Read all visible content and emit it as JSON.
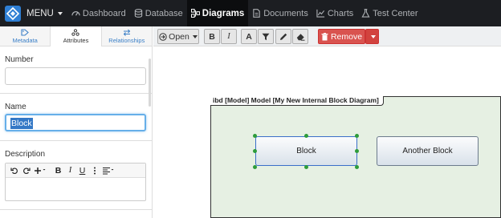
{
  "nav": {
    "menu_label": "MENU",
    "items": [
      {
        "label": "Dashboard",
        "icon": "dashboard-icon"
      },
      {
        "label": "Database",
        "icon": "database-icon"
      },
      {
        "label": "Diagrams",
        "icon": "diagrams-icon",
        "active": true
      },
      {
        "label": "Documents",
        "icon": "documents-icon"
      },
      {
        "label": "Charts",
        "icon": "charts-icon"
      },
      {
        "label": "Test Center",
        "icon": "test-center-icon"
      }
    ]
  },
  "sidebar": {
    "tabs": [
      {
        "label": "Metadata",
        "icon": "metadata-icon"
      },
      {
        "label": "Attributes",
        "icon": "attributes-icon",
        "active": true
      },
      {
        "label": "Relationships",
        "icon": "relationships-icon"
      }
    ],
    "fields": {
      "number_label": "Number",
      "number_value": "",
      "name_label": "Name",
      "name_value": "Block",
      "description_label": "Description"
    }
  },
  "toolbar": {
    "open_label": "Open",
    "bold": "B",
    "italic": "I",
    "font": "A",
    "remove_label": "Remove"
  },
  "diagram": {
    "frame_title": "ibd [Model] Model [My New Internal Block Diagram]",
    "blocks": [
      {
        "label": "Block",
        "selected": true
      },
      {
        "label": "Another Block",
        "selected": false
      }
    ]
  },
  "colors": {
    "nav_bg": "#1c1e22",
    "accent": "#3a7fc7",
    "danger": "#d9534f",
    "frame_bg": "#e6f0e3",
    "handle": "#2d9c3a"
  }
}
